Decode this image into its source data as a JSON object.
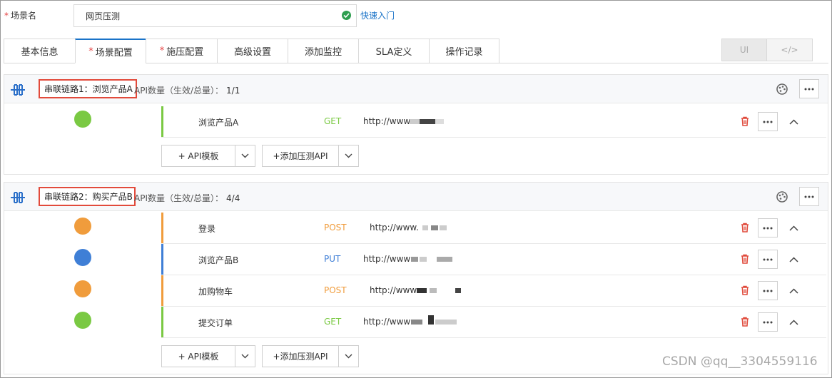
{
  "form": {
    "scene_label": "场景名",
    "scene_value": "网页压测",
    "quickstart_link": "快速入门"
  },
  "tabs": [
    {
      "label": "基本信息",
      "required": false,
      "active": false
    },
    {
      "label": "场景配置",
      "required": true,
      "active": true
    },
    {
      "label": "施压配置",
      "required": true,
      "active": false
    },
    {
      "label": "高级设置",
      "required": false,
      "active": false
    },
    {
      "label": "添加监控",
      "required": false,
      "active": false
    },
    {
      "label": "SLA定义",
      "required": false,
      "active": false
    },
    {
      "label": "操作记录",
      "required": false,
      "active": false
    }
  ],
  "mode_toggle": {
    "ui_label": "UI",
    "code_label": "</>"
  },
  "chains": [
    {
      "name": "串联链路1：浏览产品A",
      "count_label": "API数量（生效/总量）：",
      "count_value": "1/1",
      "apis": [
        {
          "name": "浏览产品A",
          "method": "GET",
          "url": "http://www",
          "color": "#7ac943"
        }
      ]
    },
    {
      "name": "串联链路2：购买产品B",
      "count_label": "API数量（生效/总量）：",
      "count_value": "4/4",
      "apis": [
        {
          "name": "登录",
          "method": "POST",
          "url": "http://www.",
          "color": "#f09c3c"
        },
        {
          "name": "浏览产品B",
          "method": "PUT",
          "url": "http://www",
          "color": "#3f7fd6"
        },
        {
          "name": "加购物车",
          "method": "POST",
          "url": "http://www",
          "color": "#f09c3c"
        },
        {
          "name": "提交订单",
          "method": "GET",
          "url": "http://www",
          "color": "#7ac943"
        }
      ]
    }
  ],
  "buttons": {
    "api_template": "+  API模板",
    "add_api": "+添加压测API"
  },
  "method_colors": {
    "GET": "#7ac943",
    "POST": "#f09c3c",
    "PUT": "#3f7fd6"
  },
  "watermark": "CSDN @qq__3304559116"
}
